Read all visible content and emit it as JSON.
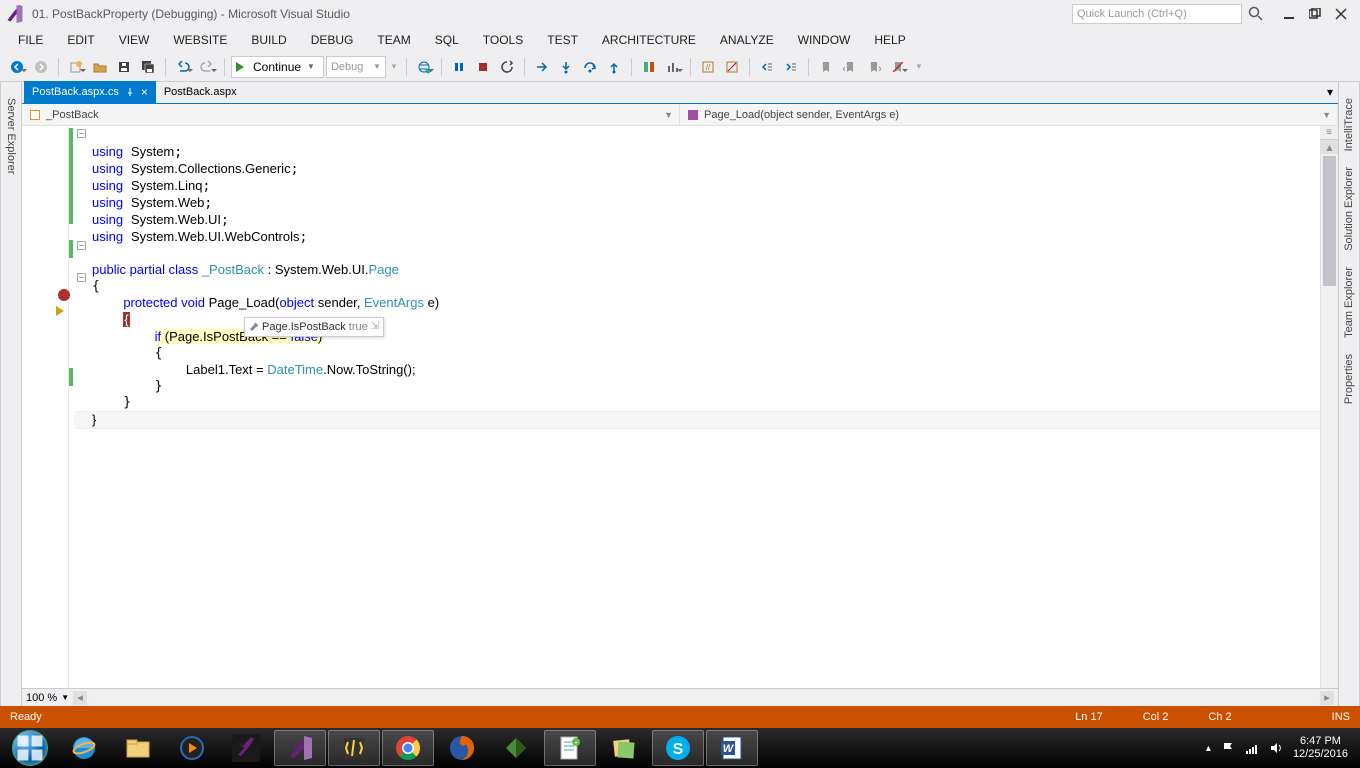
{
  "window": {
    "title": "01. PostBackProperty (Debugging) - Microsoft Visual Studio",
    "quick_launch_placeholder": "Quick Launch (Ctrl+Q)"
  },
  "menu": [
    "FILE",
    "EDIT",
    "VIEW",
    "WEBSITE",
    "BUILD",
    "DEBUG",
    "TEAM",
    "SQL",
    "TOOLS",
    "TEST",
    "ARCHITECTURE",
    "ANALYZE",
    "WINDOW",
    "HELP"
  ],
  "toolbar": {
    "continue_label": "Continue",
    "config_label": "Debug"
  },
  "left_panels": [
    "Server Explorer"
  ],
  "right_panels": [
    "IntelliTrace",
    "Solution Explorer",
    "Team Explorer",
    "Properties"
  ],
  "tabs": [
    {
      "label": "PostBack.aspx.cs",
      "active": true,
      "pinned": true
    },
    {
      "label": "PostBack.aspx",
      "active": false,
      "pinned": false
    }
  ],
  "nav": {
    "left": "_PostBack",
    "right": "Page_Load(object sender, EventArgs e)"
  },
  "code": {
    "usings": [
      "System",
      "System.Collections.Generic",
      "System.Linq",
      "System.Web",
      "System.Web.UI",
      "System.Web.UI.WebControls"
    ],
    "class_decl_pre": "public partial class ",
    "class_name": "_PostBack",
    "class_decl_post": " : System.Web.UI.",
    "page_type": "Page",
    "method_sig_pre": "protected void",
    "method_name": " Page_Load(",
    "method_param1": "object",
    "method_param_mid": " sender, ",
    "method_param2": "EventArgs",
    "method_sig_post": " e)",
    "if_kw": "if",
    "if_cond": " (Page.IsPostBack == ",
    "false_kw": "false",
    "if_close": ")",
    "label_pre": "Label1.Text = ",
    "datetime": "DateTime",
    "label_post": ".Now.ToString();",
    "tooltip_label": "Page.IsPostBack",
    "tooltip_value": "true"
  },
  "zoom": "100 %",
  "status": {
    "ready": "Ready",
    "ln": "Ln 17",
    "col": "Col 2",
    "ch": "Ch 2",
    "ins": "INS"
  },
  "systray": {
    "time": "6:47 PM",
    "date": "12/25/2016"
  }
}
